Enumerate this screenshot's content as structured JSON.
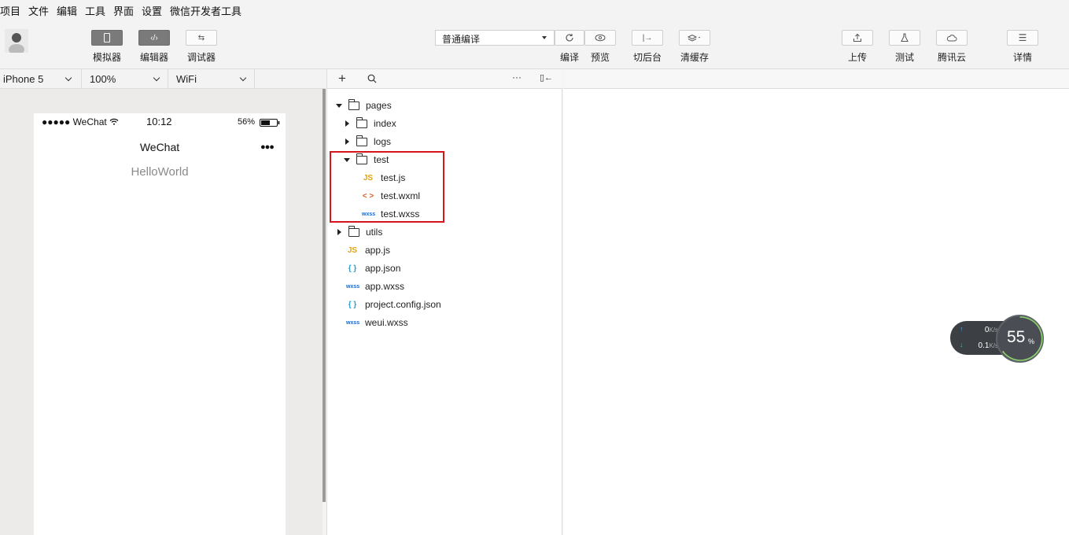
{
  "menubar": [
    "项目",
    "文件",
    "编辑",
    "工具",
    "界面",
    "设置",
    "微信开发者工具"
  ],
  "toolbar": {
    "simulator": "模拟器",
    "editor": "编辑器",
    "debugger": "调试器",
    "compile_mode": "普通编译",
    "compile": "编译",
    "preview": "预览",
    "background": "切后台",
    "clear_cache": "清缓存",
    "upload": "上传",
    "test": "测试",
    "tencent_cloud": "腾讯云",
    "details": "详情"
  },
  "simbar": {
    "device": "iPhone 5",
    "zoom": "100%",
    "network": "WiFi"
  },
  "phone": {
    "carrier": "●●●●● WeChat",
    "time": "10:12",
    "battery": "56%",
    "nav_title": "WeChat",
    "more": "●●●",
    "content": "HelloWorld"
  },
  "tree": {
    "pages": "pages",
    "index": "index",
    "logs": "logs",
    "test": "test",
    "test_js": "test.js",
    "test_wxml": "test.wxml",
    "test_wxss": "test.wxss",
    "utils": "utils",
    "app_js": "app.js",
    "app_json": "app.json",
    "app_wxss": "app.wxss",
    "project_config": "project.config.json",
    "weui_wxss": "weui.wxss"
  },
  "icons": {
    "js": "JS",
    "xml": "< >",
    "wxss": "wxss",
    "json": "{ }"
  },
  "speed": {
    "up": "0",
    "up_unit": "K/s",
    "down": "0.1",
    "down_unit": "K/s",
    "percent": "55",
    "percent_unit": "%"
  }
}
